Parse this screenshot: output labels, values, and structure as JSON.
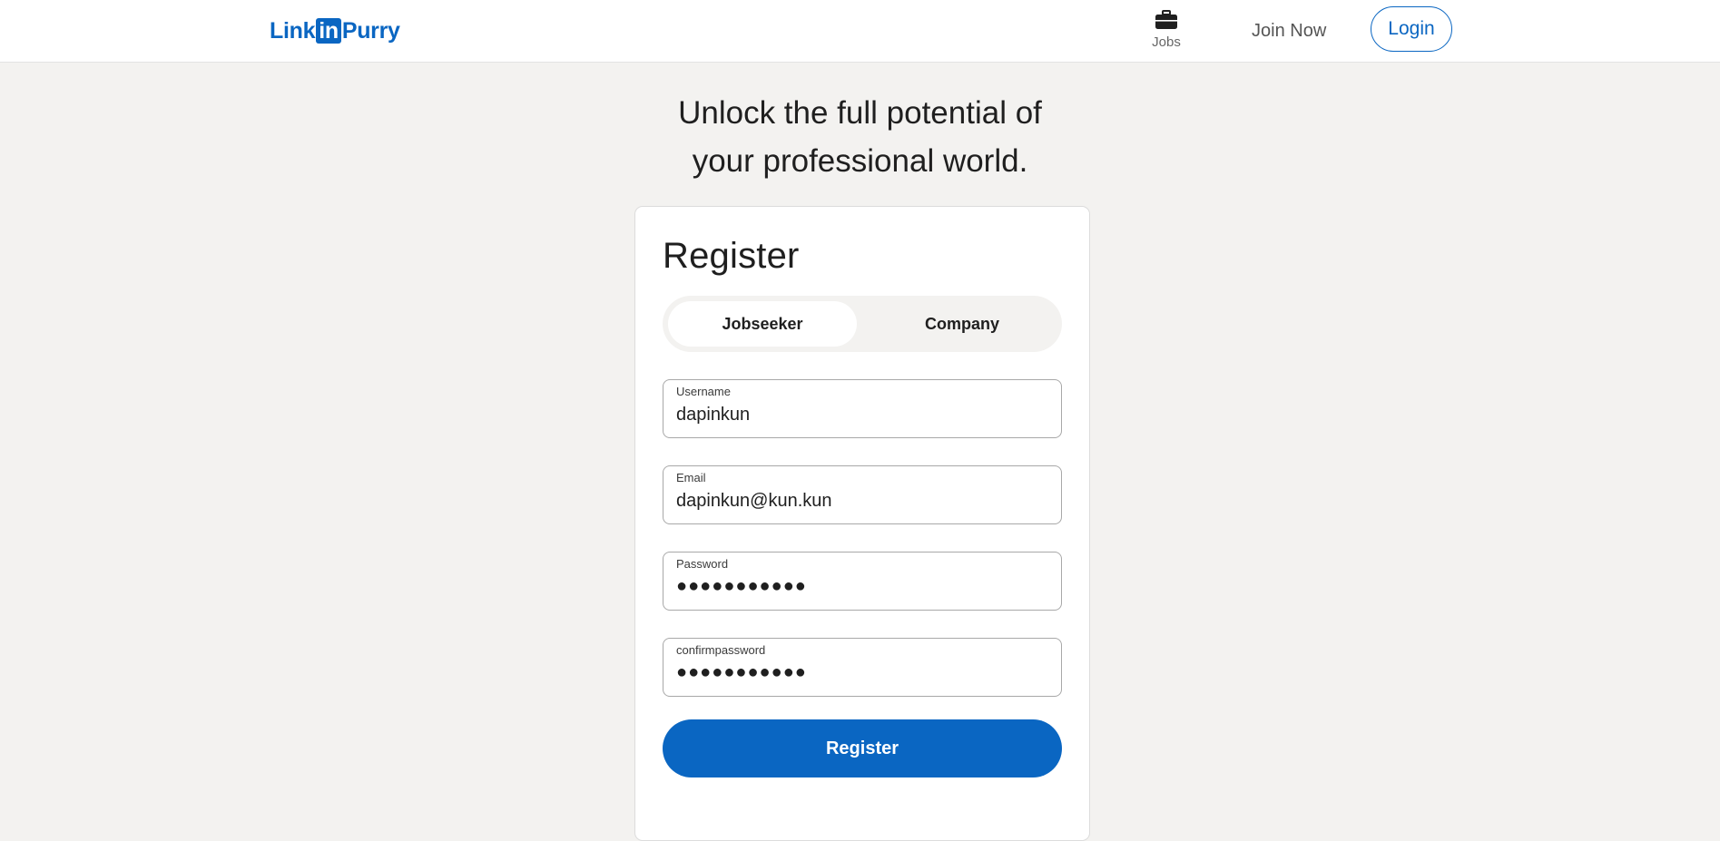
{
  "header": {
    "logo": {
      "part1": "Link",
      "part2": "in",
      "part3": "Purry"
    },
    "nav": {
      "jobs_label": "Jobs",
      "jobs_icon": "briefcase-icon",
      "join_now_label": "Join Now",
      "login_label": "Login"
    }
  },
  "main": {
    "headline_line1": "Unlock the full potential of",
    "headline_line2": "your professional world."
  },
  "form": {
    "title": "Register",
    "tabs": {
      "jobseeker_label": "Jobseeker",
      "company_label": "Company",
      "selected": "Jobseeker"
    },
    "username": {
      "label": "Username",
      "value": "dapinkun"
    },
    "email": {
      "label": "Email",
      "value": "dapinkun@kun.kun"
    },
    "password": {
      "label": "Password",
      "value": "●●●●●●●●●●●"
    },
    "confirmpassword": {
      "label": "confirmpassword",
      "value": "●●●●●●●●●●●"
    },
    "submit_label": "Register"
  },
  "colors": {
    "brand": "#0a66c2",
    "page_background": "#f3f2f0",
    "card_background": "#ffffff"
  }
}
